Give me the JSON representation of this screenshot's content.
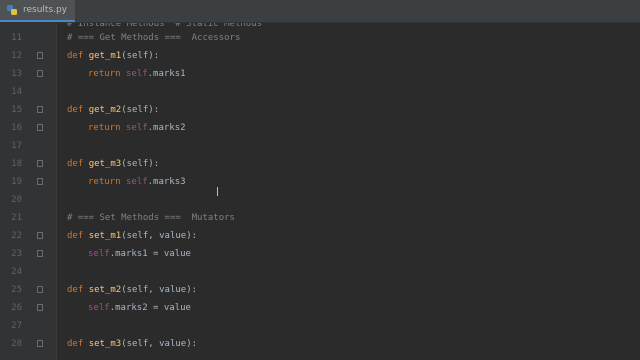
{
  "tab": {
    "filename": "results.py",
    "icon": "python-file-icon"
  },
  "colors": {
    "background": "#2b2b2b",
    "keyword": "#cc7832",
    "function": "#ffc66d",
    "self": "#94558d",
    "comment": "#808080",
    "text": "#a9b7c6"
  },
  "header_partial": "# Instance Methods  # Static Methods",
  "lines": [
    {
      "n": "11",
      "text": "# === Get Methods ===  Accessors"
    },
    {
      "n": "12",
      "kw": "def",
      "fn": "get_m1",
      "args": "(self):"
    },
    {
      "n": "13",
      "ret": "return",
      "self": "self",
      "attr": ".marks1"
    },
    {
      "n": "14"
    },
    {
      "n": "15",
      "kw": "def",
      "fn": "get_m2",
      "args": "(self):"
    },
    {
      "n": "16",
      "ret": "return",
      "self": "self",
      "attr": ".marks2"
    },
    {
      "n": "17"
    },
    {
      "n": "18",
      "kw": "def",
      "fn": "get_m3",
      "args": "(self):"
    },
    {
      "n": "19",
      "ret": "return",
      "self": "self",
      "attr": ".marks3"
    },
    {
      "n": "20"
    },
    {
      "n": "21",
      "text": "# === Set Methods ===  Mutators"
    },
    {
      "n": "22",
      "kw": "def",
      "fn": "set_m1",
      "args": "(self, value):"
    },
    {
      "n": "23",
      "self": "self",
      "attr": ".marks1 = value"
    },
    {
      "n": "24"
    },
    {
      "n": "25",
      "kw": "def",
      "fn": "set_m2",
      "args": "(self, value):"
    },
    {
      "n": "26",
      "self": "self",
      "attr": ".marks2 = value"
    },
    {
      "n": "27"
    },
    {
      "n": "28",
      "kw": "def",
      "fn": "set_m3",
      "args": "(self, value):"
    }
  ]
}
